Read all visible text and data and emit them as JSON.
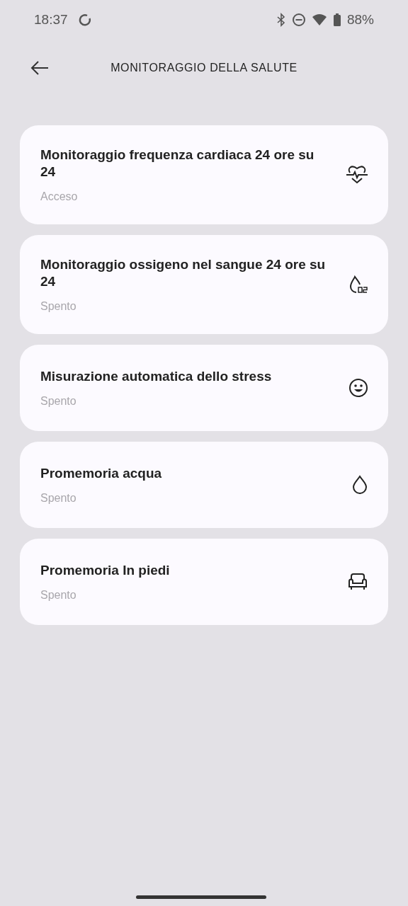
{
  "status_bar": {
    "time": "18:37",
    "battery": "88%"
  },
  "header": {
    "title": "MONITORAGGIO DELLA SALUTE"
  },
  "settings": [
    {
      "title": "Monitoraggio frequenza cardiaca 24 ore su 24",
      "status": "Acceso",
      "kind": "heart"
    },
    {
      "title": "Monitoraggio ossigeno nel sangue 24 ore su 24",
      "status": "Spento",
      "kind": "oxygen"
    },
    {
      "title": "Misurazione automatica dello stress",
      "status": "Spento",
      "kind": "stress"
    },
    {
      "title": "Promemoria acqua",
      "status": "Spento",
      "kind": "water"
    },
    {
      "title": "Promemoria In piedi",
      "status": "Spento",
      "kind": "sofa"
    }
  ]
}
